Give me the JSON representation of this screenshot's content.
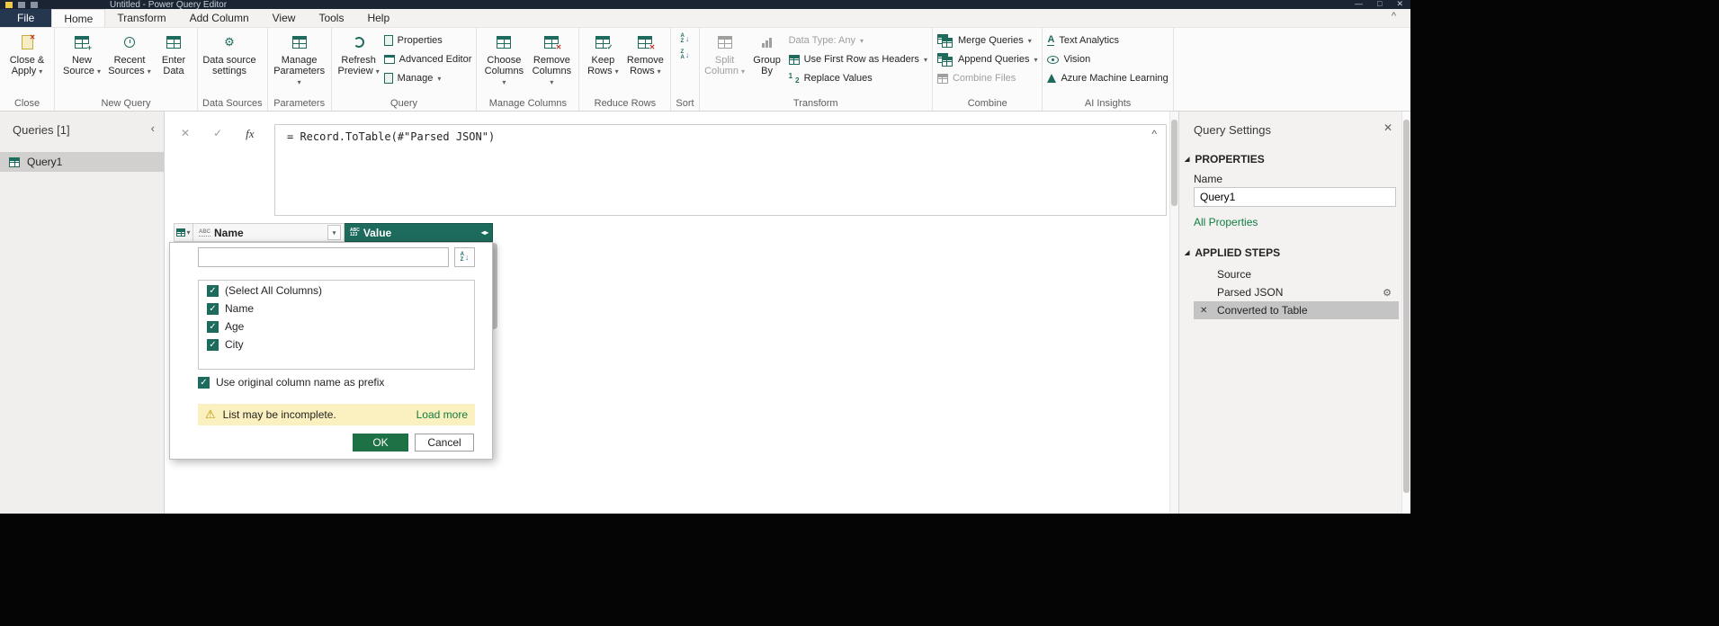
{
  "icons": {
    "caret_down": "▾",
    "chevron_up": "^",
    "chevron_left": "‹",
    "close": "✕",
    "check": "✓",
    "fx": "fx",
    "warning": "⚠",
    "gear": "⚙",
    "minimize": "—",
    "maximize": "□",
    "section_triangle": "◢",
    "resize_icon": "◂▸",
    "sort_a": "A",
    "sort_z": "Z",
    "sort_arrow": "↓",
    "digit_one": "1",
    "digit_two": "2"
  },
  "titlebar": {
    "title": "Untitled - Power Query Editor"
  },
  "menubar": {
    "tabs": [
      "File",
      "Home",
      "Transform",
      "Add Column",
      "View",
      "Tools",
      "Help"
    ]
  },
  "ribbon": {
    "groups": {
      "close": {
        "label": "Close",
        "close_apply": "Close & Apply"
      },
      "new_query": {
        "label": "New Query",
        "new_source": "New Source",
        "recent_sources": "Recent Sources",
        "enter_data": "Enter Data"
      },
      "data_sources": {
        "label": "Data Sources",
        "settings": "Data source settings"
      },
      "parameters": {
        "label": "Parameters",
        "manage_parameters": "Manage Parameters"
      },
      "query": {
        "label": "Query",
        "refresh_preview": "Refresh Preview",
        "properties": "Properties",
        "advanced_editor": "Advanced Editor",
        "manage": "Manage"
      },
      "manage_columns": {
        "label": "Manage Columns",
        "choose_columns": "Choose Columns",
        "remove_columns": "Remove Columns"
      },
      "reduce_rows": {
        "label": "Reduce Rows",
        "keep_rows": "Keep Rows",
        "remove_rows": "Remove Rows"
      },
      "sort": {
        "label": "Sort"
      },
      "transform": {
        "label": "Transform",
        "split_column": "Split Column",
        "group_by": "Group By",
        "data_type": "Data Type: Any",
        "first_row": "Use First Row as Headers",
        "replace_values": "Replace Values"
      },
      "combine": {
        "label": "Combine",
        "merge_queries": "Merge Queries",
        "append_queries": "Append Queries",
        "combine_files": "Combine Files"
      },
      "ai": {
        "label": "AI Insights",
        "text_analytics": "Text Analytics",
        "vision": "Vision",
        "azure_ml": "Azure Machine Learning"
      }
    }
  },
  "queries_pane": {
    "header": "Queries [1]",
    "items": [
      {
        "name": "Query1"
      }
    ]
  },
  "formula_bar": {
    "formula": "= Record.ToTable(#\"Parsed JSON\")"
  },
  "grid": {
    "columns": [
      {
        "type_icon": "ABC",
        "name": "Name"
      },
      {
        "type_icon_top": "ABC",
        "type_icon_bottom": "123",
        "name": "Value"
      }
    ]
  },
  "filter_popup": {
    "items": [
      {
        "label": "(Select All Columns)",
        "checked": true
      },
      {
        "label": "Name",
        "checked": true
      },
      {
        "label": "Age",
        "checked": true
      },
      {
        "label": "City",
        "checked": true
      }
    ],
    "prefix_label": "Use original column name as prefix",
    "warning_text": "List may be incomplete.",
    "load_more": "Load more",
    "ok": "OK",
    "cancel": "Cancel"
  },
  "settings_pane": {
    "title": "Query Settings",
    "properties_header": "PROPERTIES",
    "name_label": "Name",
    "name_value": "Query1",
    "all_properties": "All Properties",
    "applied_steps_header": "APPLIED STEPS",
    "steps": [
      {
        "label": "Source"
      },
      {
        "label": "Parsed JSON",
        "gear": true
      },
      {
        "label": "Converted to Table",
        "selected": true,
        "removable": true
      }
    ]
  },
  "colors": {
    "accent_teal": "#1d6b5c",
    "ok_button_green": "#1e7145",
    "link_green": "#107c41",
    "warning_bg": "#fbf0bf",
    "selected_step_bg": "#c4c4c4",
    "file_tab_bg": "#25364f"
  }
}
